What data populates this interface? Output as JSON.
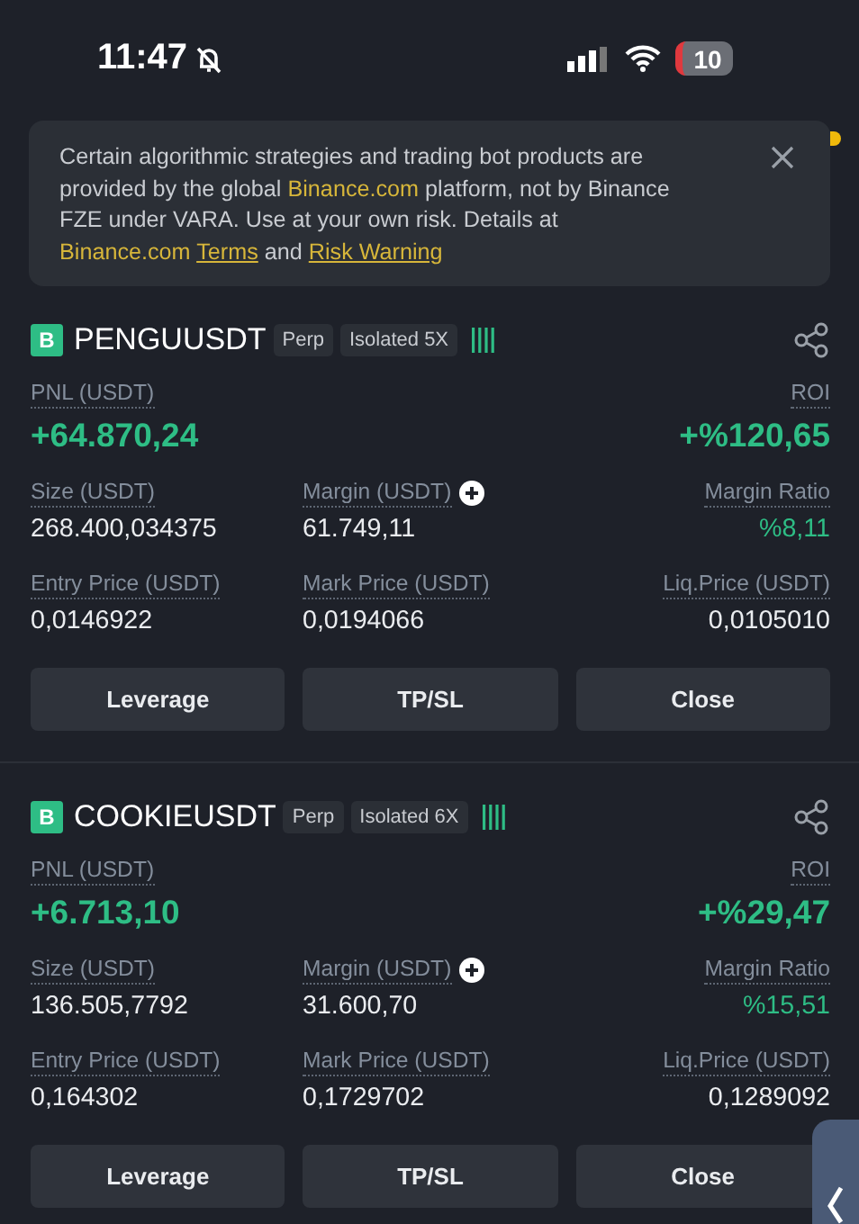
{
  "status_bar": {
    "time": "11:47",
    "battery": "10"
  },
  "notice": {
    "parts": [
      {
        "kind": "text",
        "text": "Certain algorithmic strategies and trading bot products are provided by the global "
      },
      {
        "kind": "link",
        "text": "Binance.com"
      },
      {
        "kind": "text",
        "text": " platform, not by Binance FZE under VARA. Use at your own risk. Details at "
      },
      {
        "kind": "link",
        "text": "Binance.com "
      },
      {
        "kind": "underlined_link",
        "text": "Terms"
      },
      {
        "kind": "text",
        "text": "  and "
      },
      {
        "kind": "underlined_link",
        "text": "Risk Warning"
      }
    ]
  },
  "positions": [
    {
      "badge": "B",
      "symbol": "PENGUUSDT",
      "type": "Perp",
      "margin_mode": "Isolated 5X",
      "pnl": {
        "label": "PNL (USDT)",
        "value": "+64.870,24"
      },
      "roi": {
        "label": "ROI",
        "value": "+%120,65"
      },
      "size": {
        "label": "Size (USDT)",
        "value": "268.400,034375"
      },
      "margin": {
        "label": "Margin (USDT)",
        "value": "61.749,11"
      },
      "margin_ratio": {
        "label": "Margin Ratio",
        "value": "%8,11"
      },
      "entry_price": {
        "label": "Entry Price (USDT)",
        "value": "0,0146922"
      },
      "mark_price": {
        "label": "Mark Price (USDT)",
        "value": "0,0194066"
      },
      "liq_price": {
        "label": "Liq.Price (USDT)",
        "value": "0,0105010"
      },
      "buttons": [
        "Leverage",
        "TP/SL",
        "Close"
      ]
    },
    {
      "badge": "B",
      "symbol": "COOKIEUSDT",
      "type": "Perp",
      "margin_mode": "Isolated 6X",
      "pnl": {
        "label": "PNL (USDT)",
        "value": "+6.713,10"
      },
      "roi": {
        "label": "ROI",
        "value": "+%29,47"
      },
      "size": {
        "label": "Size (USDT)",
        "value": "136.505,7792"
      },
      "margin": {
        "label": "Margin (USDT)",
        "value": "31.600,70"
      },
      "margin_ratio": {
        "label": "Margin Ratio",
        "value": "%15,51"
      },
      "entry_price": {
        "label": "Entry Price (USDT)",
        "value": "0,164302"
      },
      "mark_price": {
        "label": "Mark Price (USDT)",
        "value": "0,1729702"
      },
      "liq_price": {
        "label": "Liq.Price (USDT)",
        "value": "0,1289092"
      },
      "buttons": [
        "Leverage",
        "TP/SL",
        "Close"
      ]
    }
  ]
}
